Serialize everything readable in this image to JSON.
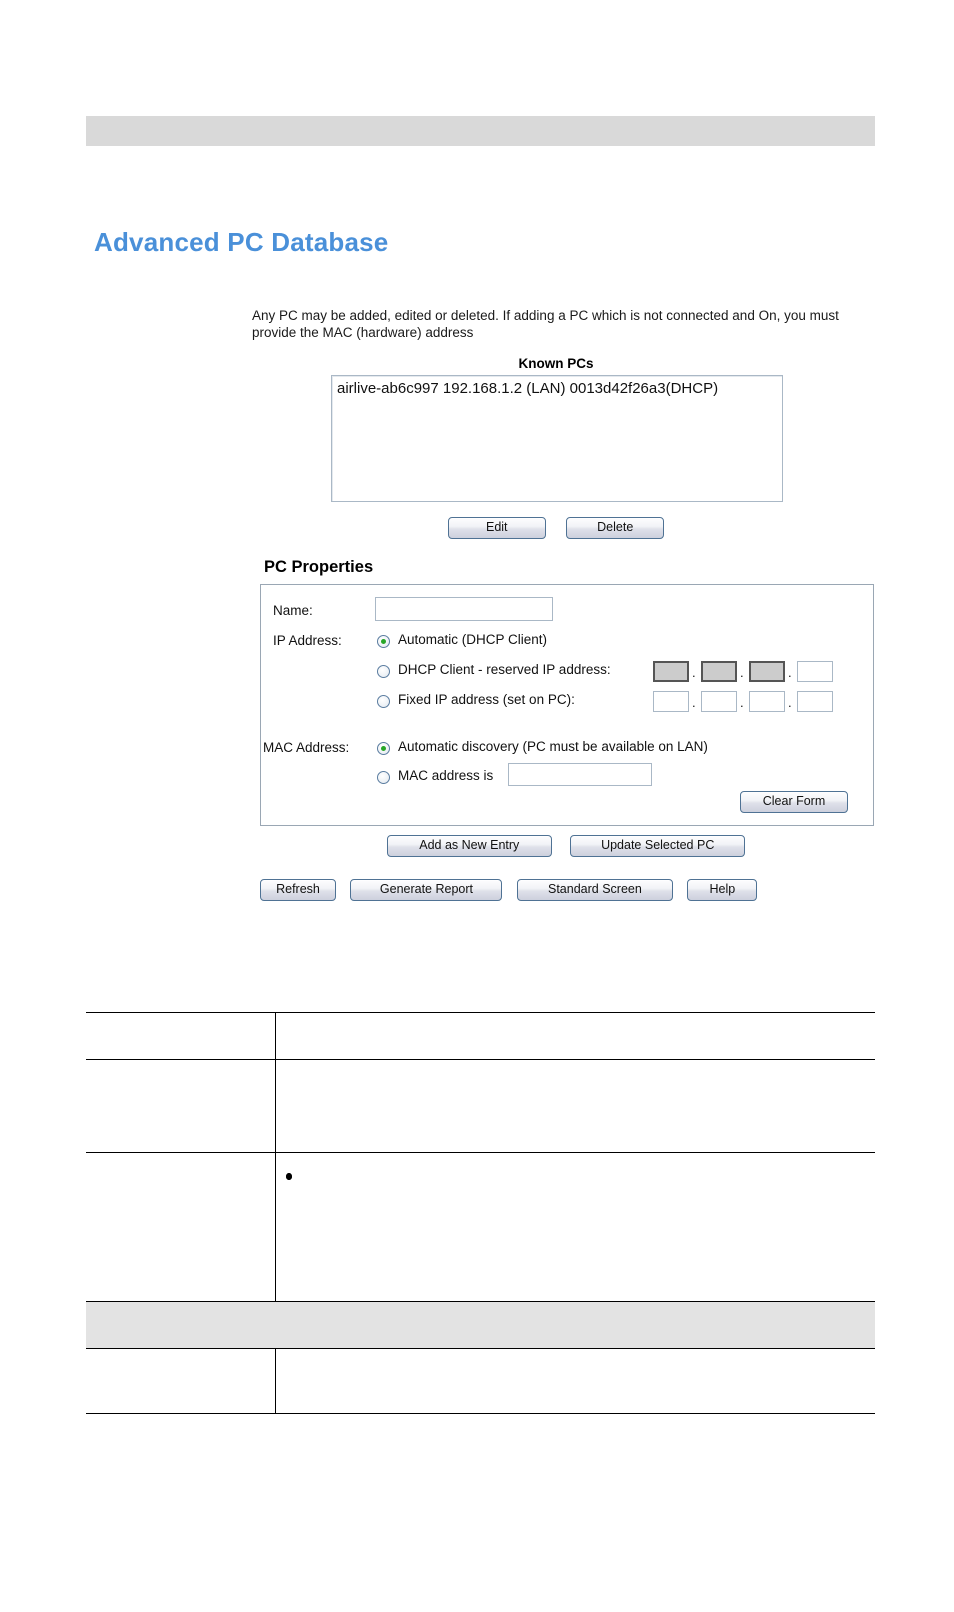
{
  "page": {
    "title": "Advanced PC Database",
    "intro": "Any PC may be added, edited or deleted. If adding a PC which is not connected and On, you must provide the MAC (hardware) address",
    "title_color": "#4a90d9"
  },
  "known_pcs": {
    "label": "Known PCs",
    "entries": [
      "airlive-ab6c997 192.168.1.2 (LAN) 0013d42f26a3(DHCP)"
    ],
    "edit_label": "Edit",
    "delete_label": "Delete"
  },
  "pc_properties": {
    "section_title": "PC Properties",
    "name_label": "Name:",
    "name_value": "",
    "ip_label": "IP Address:",
    "ip_options": [
      {
        "label": "Automatic (DHCP Client)",
        "selected": true
      },
      {
        "label": "DHCP Client - reserved IP address:",
        "selected": false
      },
      {
        "label": "Fixed IP address (set on PC):",
        "selected": false
      }
    ],
    "reserved_ip_octets": [
      "",
      "",
      "",
      ""
    ],
    "fixed_ip_octets": [
      "",
      "",
      "",
      ""
    ],
    "octet_separator": ".",
    "mac_label": "MAC Address:",
    "mac_options": [
      {
        "label": "Automatic discovery (PC must be available on LAN)",
        "selected": true
      },
      {
        "label": "MAC address is",
        "selected": false
      }
    ],
    "mac_value": "",
    "clear_form_label": "Clear Form"
  },
  "actions": {
    "add_label": "Add as New Entry",
    "update_label": "Update Selected PC",
    "refresh_label": "Refresh",
    "generate_report_label": "Generate Report",
    "standard_screen_label": "Standard Screen",
    "help_label": "Help"
  },
  "info_table": {
    "rows": [
      {
        "col_a": "",
        "col_b": ""
      },
      {
        "col_a": "",
        "col_b": ""
      },
      {
        "col_a": "",
        "col_b": "",
        "bullets": [
          "",
          ""
        ]
      },
      {
        "col_a": "",
        "col_b": "",
        "section": true
      },
      {
        "col_a": "",
        "col_b": ""
      }
    ]
  }
}
